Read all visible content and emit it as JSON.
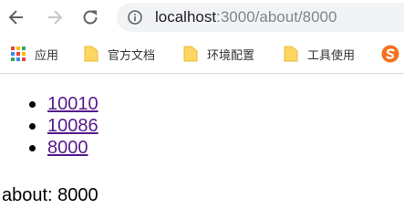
{
  "toolbar": {
    "back_icon": "arrow-left-icon",
    "forward_icon": "arrow-right-icon",
    "reload_icon": "reload-icon",
    "info_icon": "info-icon"
  },
  "address_bar": {
    "host": "localhost",
    "path": ":3000/about/8000"
  },
  "bookmarks": {
    "items": [
      {
        "label": "应用",
        "icon": "apps-grid-icon"
      },
      {
        "label": "官方文档",
        "icon": "folder-icon"
      },
      {
        "label": "环境配置",
        "icon": "folder-icon"
      },
      {
        "label": "工具使用",
        "icon": "folder-icon"
      },
      {
        "label": "",
        "icon": "s-logo-icon"
      }
    ]
  },
  "page": {
    "links": [
      {
        "label": "10010"
      },
      {
        "label": "10086"
      },
      {
        "label": "8000"
      }
    ],
    "about_text": "about: 8000"
  },
  "colors": {
    "link_visited": "#551a8b",
    "omnibox_bg": "#f1f3f4",
    "folder": "#fdd663",
    "s_logo": "#f4711d"
  }
}
